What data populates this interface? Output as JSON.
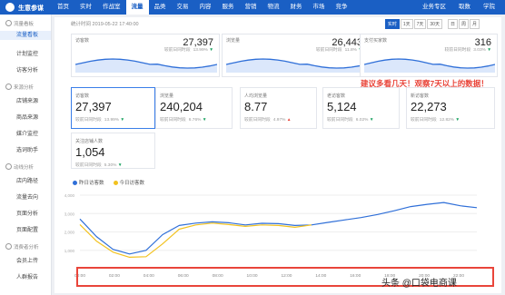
{
  "brand": {
    "name": "生意参谋"
  },
  "nav": {
    "items": [
      "首页",
      "实时",
      "作战室",
      "流量",
      "品类",
      "交易",
      "内容",
      "服务",
      "营销",
      "物流",
      "财务",
      "市场",
      "竞争"
    ],
    "active": 3,
    "hot_badges": {
      "4": "新",
      "7": "新",
      "9": "新"
    },
    "right": [
      "业务专区",
      "取数",
      "学院"
    ]
  },
  "sidebar": {
    "sections": [
      {
        "title": "流量看板",
        "items": [
          "流量看板",
          "计划监控",
          "访客分析"
        ]
      },
      {
        "title": "来源分析",
        "items": [
          "店铺来源",
          "商品来源",
          "媒介监控",
          "选词助手"
        ]
      },
      {
        "title": "动线分析",
        "items": [
          "店内路径",
          "流量去向",
          "页面分析",
          "页面配置"
        ]
      },
      {
        "title": "消费者分析",
        "items": [
          "会员上传",
          "人群报告"
        ]
      }
    ],
    "active_item": "流量看板"
  },
  "toolbar": {
    "stat_time": "统计时间 2019-05-22 17:40:00",
    "ranges": [
      "实时",
      "1天",
      "7天",
      "30天",
      "日",
      "周",
      "月"
    ],
    "active_range": "实时"
  },
  "top_cards": [
    {
      "label": "访客数",
      "value": "27,397",
      "compare_label": "较前日同时段",
      "change": "13.99%",
      "dir": "down"
    },
    {
      "label": "浏览量",
      "value": "26,443",
      "compare_label": "较前日同时段",
      "change": "11.8%",
      "dir": "down"
    },
    {
      "label": "支付买家数",
      "value": "316",
      "compare_label": "较前日同时段",
      "change": "3.03%",
      "dir": "down"
    }
  ],
  "tiles": [
    {
      "label": "访客数",
      "value": "27,397",
      "compare_label": "较前日同时段",
      "change": "13.99%",
      "dir": "down"
    },
    {
      "label": "浏览量",
      "value": "240,204",
      "compare_label": "较前日同时段",
      "change": "6.76%",
      "dir": "down"
    },
    {
      "label": "人均浏览量",
      "value": "8.77",
      "compare_label": "较前日同时段",
      "change": "4.97%",
      "dir": "up"
    },
    {
      "label": "老访客数",
      "value": "5,124",
      "compare_label": "较前日同时段",
      "change": "6.02%",
      "dir": "down"
    },
    {
      "label": "新访客数",
      "value": "22,273",
      "compare_label": "较前日同时段",
      "change": "12.82%",
      "dir": "down"
    },
    {
      "label": "关注店铺人数",
      "value": "1,054",
      "compare_label": "较前日同时段",
      "change": "5.30%",
      "dir": "down"
    }
  ],
  "annotation": "建议多看几天！观察7天以上的数据！",
  "watermark": "头条 @口袋电商课",
  "colors": {
    "primary": "#1a5fc4",
    "series_today": "#2f6fd8",
    "series_yesterday": "#f2c21f",
    "alert": "#e9453a",
    "up": "#e9453a",
    "down": "#1aa260"
  },
  "chart_data": {
    "type": "line",
    "legend": [
      "昨日访客数",
      "今日访客数"
    ],
    "x": [
      "00:00",
      "02:00",
      "04:00",
      "06:00",
      "08:00",
      "10:00",
      "12:00",
      "14:00",
      "16:00",
      "18:00",
      "20:00",
      "22:00"
    ],
    "ylim": [
      0,
      4000
    ],
    "yticks": [
      "4,000",
      "3,000",
      "2,000",
      "1,000"
    ],
    "series": [
      {
        "name": "昨日访客数",
        "color": "#2f6fd8",
        "values": [
          2700,
          1750,
          1050,
          800,
          1000,
          1850,
          2350,
          2480,
          2550,
          2500,
          2380,
          2470,
          2450,
          2350,
          2380,
          2520,
          2650,
          2780,
          2950,
          3150,
          3380,
          3500,
          3600,
          3420,
          3320
        ]
      },
      {
        "name": "今日访客数",
        "color": "#f2c21f",
        "values": [
          2400,
          1500,
          900,
          620,
          650,
          1350,
          2150,
          2380,
          2480,
          2400,
          2300,
          2380,
          2350,
          2250,
          2380
        ]
      }
    ]
  }
}
